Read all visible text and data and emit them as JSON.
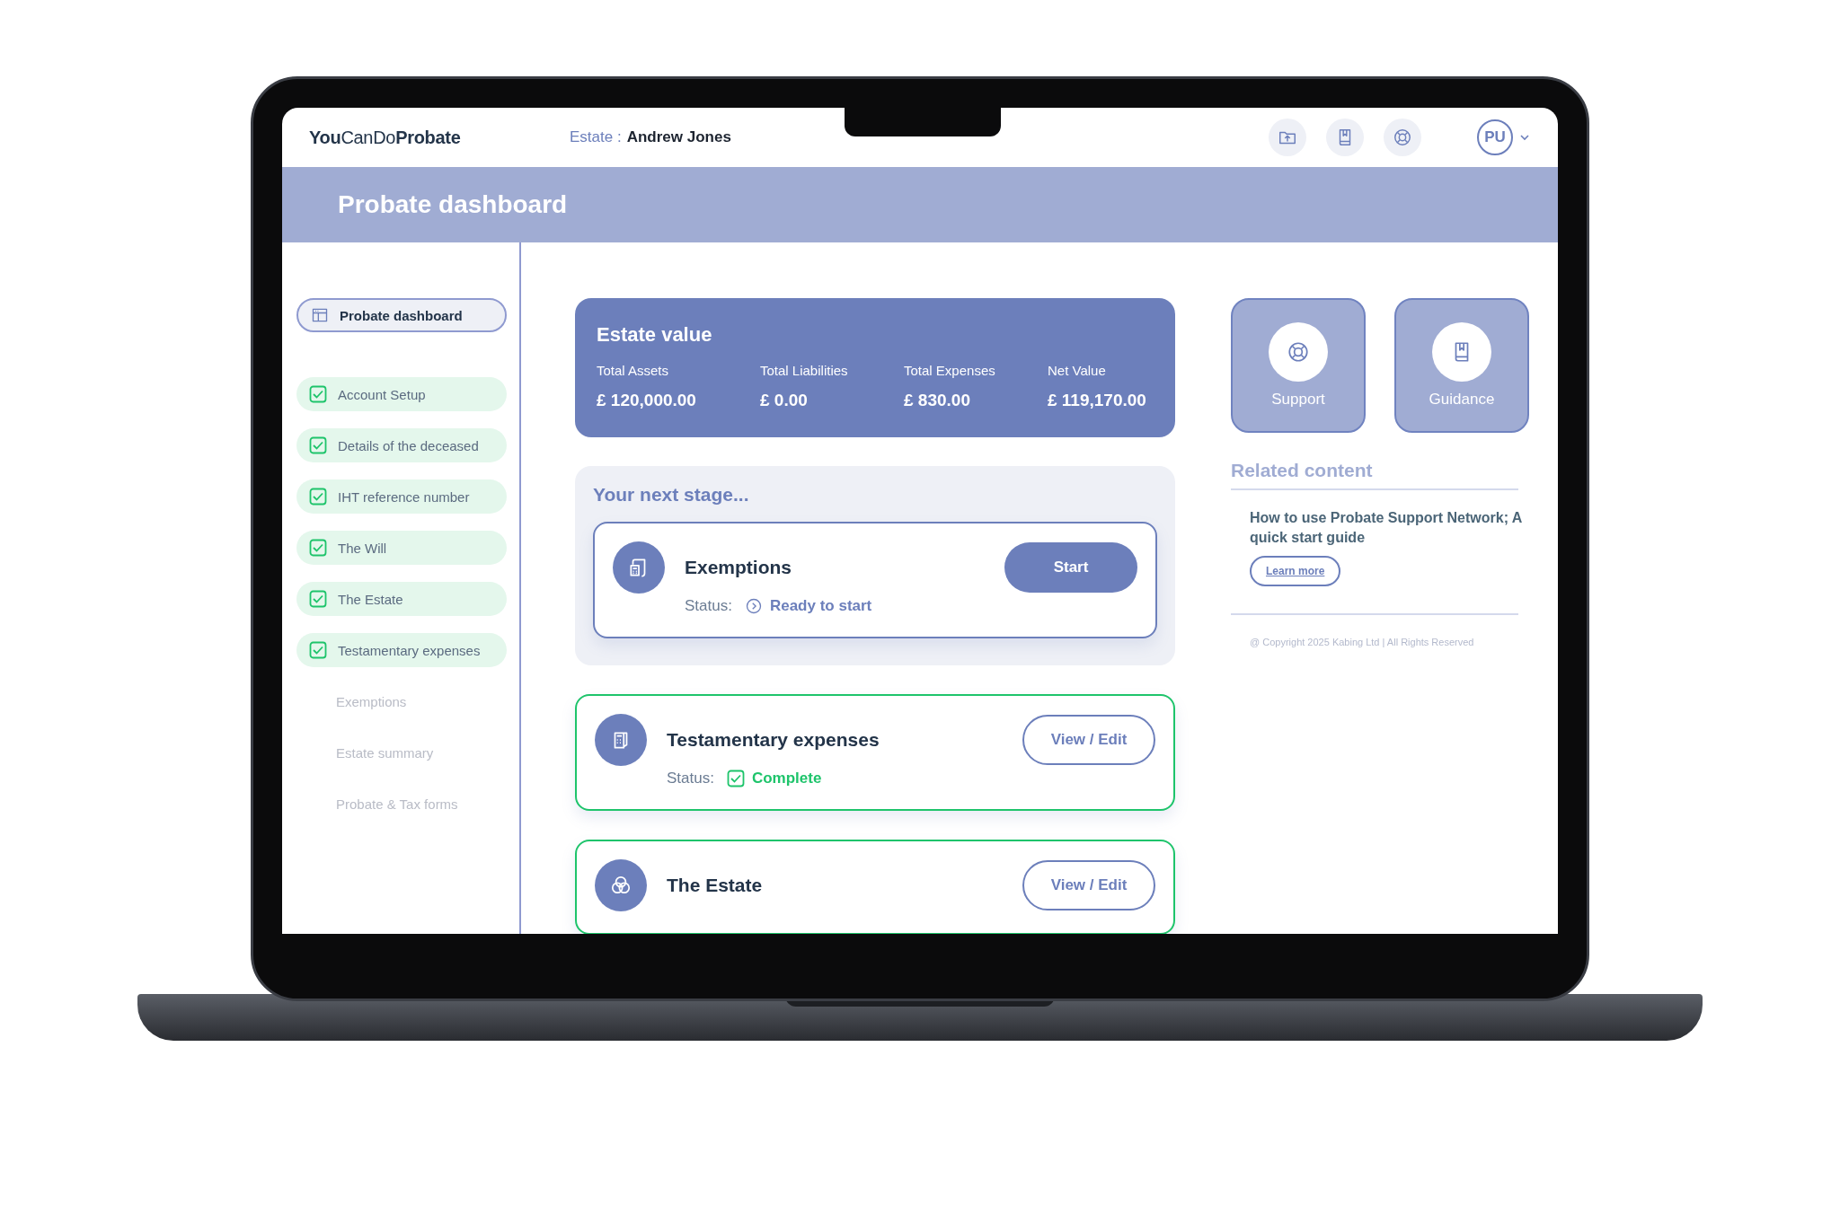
{
  "header": {
    "logo": "**You**CanDo**Probate**",
    "estate_label": "Estate :",
    "estate_name": "Andrew Jones",
    "avatar": "PU"
  },
  "banner": {
    "title": "Probate dashboard"
  },
  "sidebar": {
    "items": [
      {
        "label": "Probate dashboard",
        "kind": "dashboard",
        "selected": true
      },
      {
        "label": "Account Setup",
        "kind": "step",
        "checked": true,
        "selected": false
      },
      {
        "label": "Details of the deceased",
        "kind": "step",
        "checked": true,
        "selected": false
      },
      {
        "label": "IHT reference number",
        "kind": "step",
        "checked": true,
        "selected": false
      },
      {
        "label": "The Will",
        "kind": "step",
        "checked": true,
        "selected": false
      },
      {
        "label": "The Estate",
        "kind": "step",
        "checked": true,
        "selected": false
      },
      {
        "label": "Testamentary expenses",
        "kind": "step",
        "checked": true,
        "selected": false
      },
      {
        "label": "Exemptions",
        "kind": "step",
        "checked": false,
        "selected": false
      },
      {
        "label": "Estate summary",
        "kind": "step",
        "checked": false,
        "selected": false
      },
      {
        "label": "Probate & Tax forms",
        "kind": "step",
        "checked": false,
        "selected": false
      }
    ]
  },
  "estate_value": {
    "title": "Estate value",
    "stats": [
      {
        "label": "Total Assets",
        "value": "£ 120,000.00"
      },
      {
        "label": "Total Liabilities",
        "value": "£ 0.00"
      },
      {
        "label": "Total Expenses",
        "value": "£ 830.00"
      },
      {
        "label": "Net Value",
        "value": "£ 119,170.00"
      }
    ]
  },
  "next_stage": {
    "title": "Your next stage...",
    "card": {
      "title": "Exemptions",
      "kind": "calculator",
      "status_label": "Status:",
      "status": "Ready to start",
      "complete": false,
      "button": "Start"
    }
  },
  "stages": [
    {
      "title": "Testamentary expenses",
      "kind": "receipt",
      "status_label": "Status:",
      "status": "Complete",
      "complete": true,
      "button": "View / Edit"
    },
    {
      "title": "The Estate",
      "kind": "circles",
      "complete": true,
      "button": "View / Edit"
    }
  ],
  "tiles": [
    {
      "label": "Support",
      "kind": "lifebuoy"
    },
    {
      "label": "Guidance",
      "kind": "book"
    }
  ],
  "related": {
    "title": "Related content",
    "article": "How to use Probate Support Network; A quick start guide",
    "link": "Learn more"
  },
  "copyright": "@ Copyright 2025 Kabing Ltd | All Rights Reserved"
}
